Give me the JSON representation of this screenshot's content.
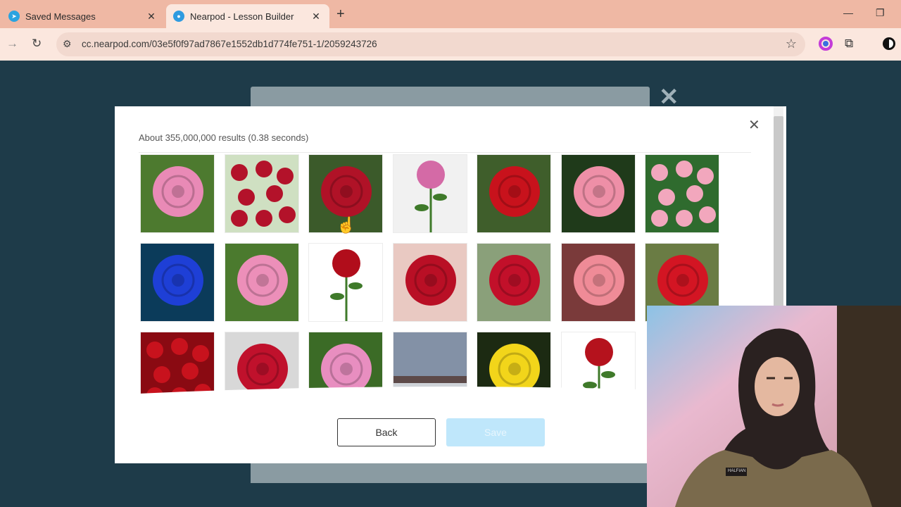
{
  "browser": {
    "tabs": [
      {
        "title": "Saved Messages",
        "active": false,
        "icon": "telegram-icon"
      },
      {
        "title": "Nearpod - Lesson Builder",
        "active": true,
        "icon": "nearpod-icon"
      }
    ],
    "url": "cc.nearpod.com/03e5f0f97ad7867e1552db1d774fe751-1/2059243726"
  },
  "modal": {
    "results_text": "About 355,000,000 results (0.38 seconds)",
    "back_label": "Back",
    "save_label": "Save",
    "images": [
      {
        "subject": "pink rose",
        "colors": [
          "#4d7a2f",
          "#e98ab6"
        ]
      },
      {
        "subject": "red rose cluster",
        "colors": [
          "#cfe0c2",
          "#b3122a"
        ]
      },
      {
        "subject": "red rose",
        "colors": [
          "#3b5a2a",
          "#b01227"
        ]
      },
      {
        "subject": "pink rose on stem",
        "colors": [
          "#f1f1f1",
          "#d46aa6"
        ]
      },
      {
        "subject": "red rose",
        "colors": [
          "#3f5e2b",
          "#c8121c"
        ]
      },
      {
        "subject": "pink rose",
        "colors": [
          "#1f3a1a",
          "#ee8fa7"
        ]
      },
      {
        "subject": "pink roses bush",
        "colors": [
          "#2f6b2e",
          "#f2a7bd"
        ]
      },
      {
        "subject": "blue rose",
        "colors": [
          "#0b3b5a",
          "#1e3fd6"
        ]
      },
      {
        "subject": "pink rose",
        "colors": [
          "#4b7a2e",
          "#ec8fb9"
        ]
      },
      {
        "subject": "red rose on stem",
        "colors": [
          "#ffffff",
          "#b10d1b"
        ]
      },
      {
        "subject": "red rose with drops",
        "colors": [
          "#e9c9c2",
          "#b90f25"
        ]
      },
      {
        "subject": "red rose",
        "colors": [
          "#8aa07a",
          "#c2102a"
        ]
      },
      {
        "subject": "pink rose",
        "colors": [
          "#7a3a3a",
          "#ef8b97"
        ]
      },
      {
        "subject": "red rose",
        "colors": [
          "#6a7c44",
          "#d31523"
        ]
      },
      {
        "subject": "red roses many",
        "colors": [
          "#8a0a12",
          "#c8121d"
        ]
      },
      {
        "subject": "red rose",
        "colors": [
          "#d8d8d8",
          "#c0112c"
        ]
      },
      {
        "subject": "pink rose",
        "colors": [
          "#3b6b26",
          "#e88ec0"
        ]
      },
      {
        "subject": "ship on sea",
        "colors": [
          "#8391a6",
          "#5d4a49"
        ]
      },
      {
        "subject": "yellow rose",
        "colors": [
          "#1c2a12",
          "#f2d51a"
        ]
      },
      {
        "subject": "red rosebud",
        "colors": [
          "#ffffff",
          "#b5121d"
        ]
      }
    ]
  },
  "webcam": {
    "badge_text": "HALFIAN"
  }
}
